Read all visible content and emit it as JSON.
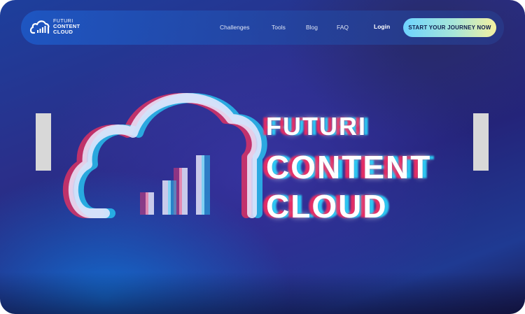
{
  "brand": {
    "line1": "FUTURI",
    "line2": "CONTENT",
    "line3": "CLOUD"
  },
  "nav": {
    "links": [
      {
        "label": "Challenges"
      },
      {
        "label": "Tools"
      },
      {
        "label": "Blog"
      },
      {
        "label": "FAQ"
      }
    ],
    "login_label": "Login",
    "cta_label": "START YOUR JOURNEY NOW"
  },
  "hero": {
    "line1": "FUTURI",
    "line2": "CONTENT",
    "line3": "CLOUD"
  },
  "colors": {
    "cta_start": "#6dd3ff",
    "cta_end": "#f4f0a0",
    "background": "#24247a"
  }
}
